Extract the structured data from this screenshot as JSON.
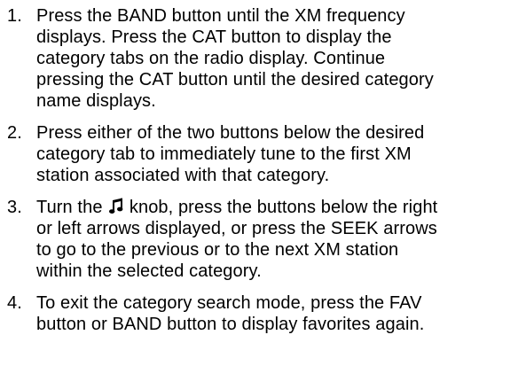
{
  "steps": [
    {
      "number": "1.",
      "text": "Press the BAND button until the XM frequency\ndisplays. Press the CAT button to display the\ncategory tabs on the radio display. Continue\npressing the CAT button until the desired category\nname displays."
    },
    {
      "number": "2.",
      "text": "Press either of the two buttons below the desired\ncategory tab to immediately tune to the first XM\nstation associated with that category."
    },
    {
      "number": "3.",
      "text_before_icon": "Turn the",
      "icon": "music-note-icon",
      "text_after_icon": " knob, press the buttons below the right\nor left arrows displayed, or press the SEEK arrows\nto go to the previous or to the next XM station\nwithin the selected category."
    },
    {
      "number": "4.",
      "text": "To exit the category search mode, press the FAV\nbutton or BAND button to display favorites again."
    }
  ]
}
